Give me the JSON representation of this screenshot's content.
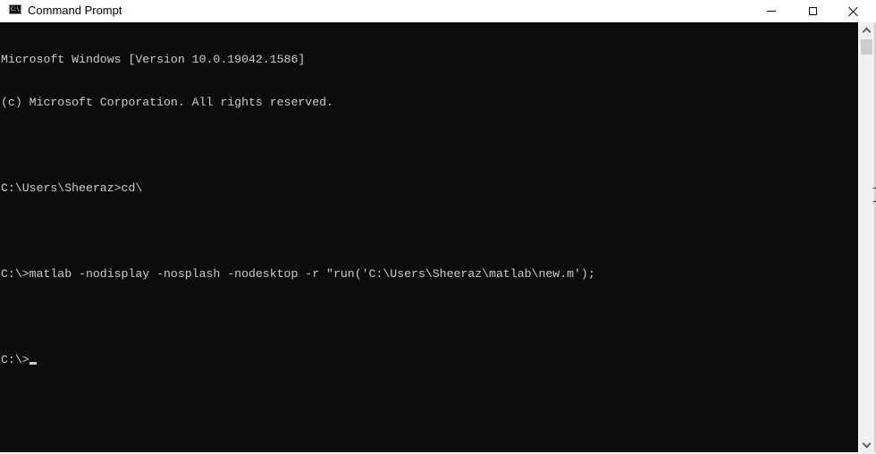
{
  "window": {
    "title": "Command Prompt",
    "icon": "cmd-icon",
    "icon_text": "C:\\.",
    "controls": {
      "minimize": "minimize-icon",
      "maximize": "maximize-icon",
      "close": "close-icon"
    }
  },
  "console": {
    "lines": [
      "Microsoft Windows [Version 10.0.19042.1586]",
      "(c) Microsoft Corporation. All rights reserved.",
      "",
      "C:\\Users\\Sheeraz>cd\\",
      "",
      "C:\\>matlab -nodisplay -nosplash -nodesktop -r \"run('C:\\Users\\Sheeraz\\matlab\\new.m');",
      "",
      "C:\\>"
    ],
    "colors": {
      "background": "#0c0c0c",
      "foreground": "#cccccc"
    }
  },
  "scrollbar": {
    "up": "chevron-up-icon",
    "down": "chevron-down-icon"
  }
}
